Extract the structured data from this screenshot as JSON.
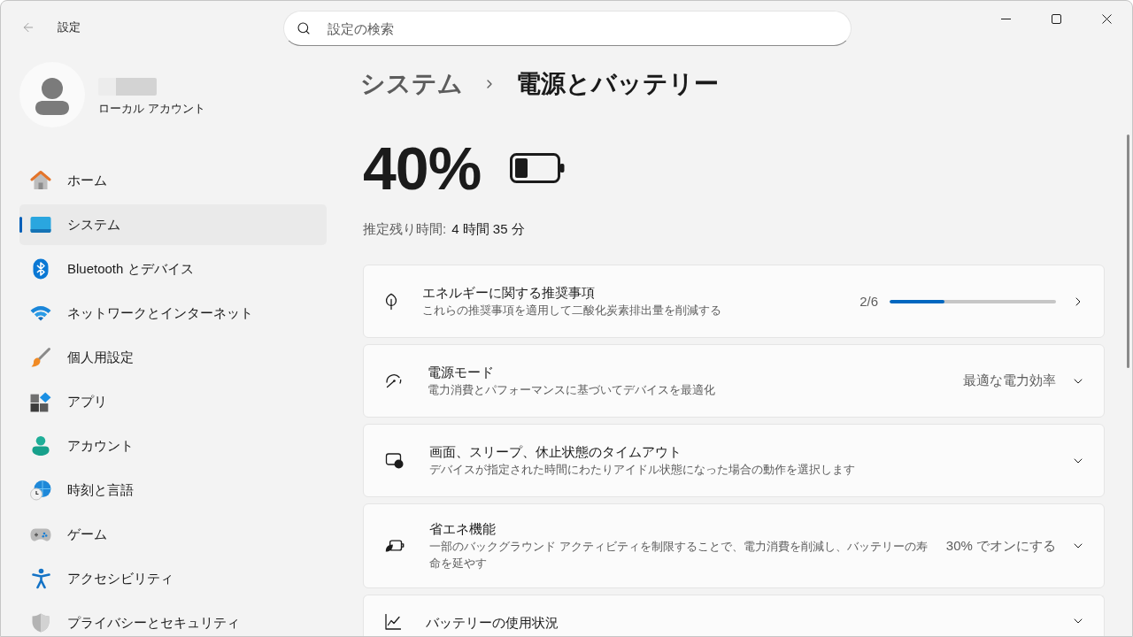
{
  "window": {
    "title": "設定",
    "search": {
      "placeholder": "設定の検索"
    }
  },
  "account": {
    "type": "ローカル アカウント"
  },
  "sidebar": {
    "items": [
      {
        "label": "ホーム",
        "selected": false
      },
      {
        "label": "システム",
        "selected": true
      },
      {
        "label": "Bluetooth とデバイス",
        "selected": false
      },
      {
        "label": "ネットワークとインターネット",
        "selected": false
      },
      {
        "label": "個人用設定",
        "selected": false
      },
      {
        "label": "アプリ",
        "selected": false
      },
      {
        "label": "アカウント",
        "selected": false
      },
      {
        "label": "時刻と言語",
        "selected": false
      },
      {
        "label": "ゲーム",
        "selected": false
      },
      {
        "label": "アクセシビリティ",
        "selected": false
      },
      {
        "label": "プライバシーとセキュリティ",
        "selected": false
      }
    ]
  },
  "breadcrumb": {
    "parent": "システム",
    "current": "電源とバッテリー"
  },
  "battery": {
    "percent": "40%",
    "estimate_label": "推定残り時間:",
    "estimate_value": "4 時間 35 分"
  },
  "cards": [
    {
      "kind": "link",
      "title": "エネルギーに関する推奨事項",
      "subtitle": "これらの推奨事項を適用して二酸化炭素排出量を削減する",
      "value": "2/6",
      "level": 0.33
    },
    {
      "kind": "expander",
      "title": "電源モード",
      "subtitle": "電力消費とパフォーマンスに基づいてデバイスを最適化",
      "value": "最適な電力効率"
    },
    {
      "kind": "expander",
      "title": "画面、スリープ、休止状態のタイムアウト",
      "subtitle": "デバイスが指定された時間にわたりアイドル状態になった場合の動作を選択します"
    },
    {
      "kind": "expander",
      "title": "省エネ機能",
      "subtitle": "一部のバックグラウンド アクティビティを制限することで、電力消費を削減し、バッテリーの寿命を延やす",
      "value": "30% でオンにする"
    },
    {
      "kind": "expander",
      "title": "バッテリーの使用状況"
    }
  ]
}
